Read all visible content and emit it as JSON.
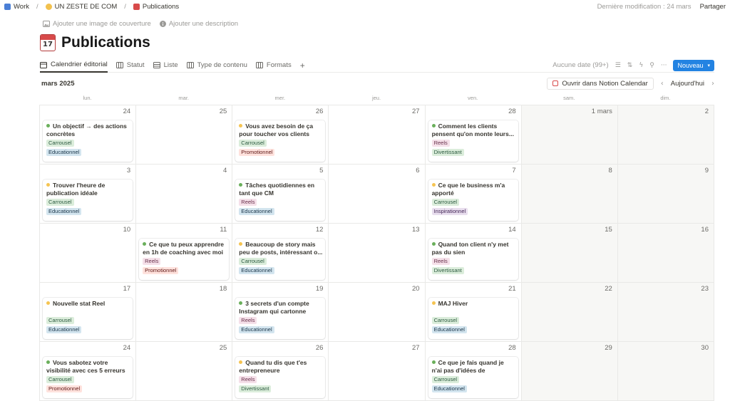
{
  "breadcrumb": {
    "items": [
      {
        "label": "Work",
        "color": "#4a7fd6"
      },
      {
        "label": "UN ZESTE DE COM",
        "color": "#f2c14e"
      },
      {
        "label": "Publications",
        "color": "#d84a4a"
      }
    ],
    "last_modified": "Dernière modification : 24 mars",
    "share": "Partager"
  },
  "page": {
    "add_cover": "Ajouter une image de couverture",
    "add_description": "Ajouter une description",
    "title": "Publications",
    "emoji_day": "17"
  },
  "views": {
    "tabs": [
      {
        "label": "Calendrier éditorial",
        "active": true
      },
      {
        "label": "Statut",
        "active": false
      },
      {
        "label": "Liste",
        "active": false
      },
      {
        "label": "Type de contenu",
        "active": false
      },
      {
        "label": "Formats",
        "active": false
      }
    ],
    "add": "+",
    "no_date": "Aucune date (99+)",
    "new_button": "Nouveau"
  },
  "calendar": {
    "month": "mars 2025",
    "open_button": "Ouvrir dans Notion Calendar",
    "today": "Aujourd'hui",
    "prev": "‹",
    "next": "›",
    "weekdays": [
      "lun.",
      "mar.",
      "mer.",
      "jeu.",
      "ven.",
      "sam.",
      "dim."
    ],
    "status_colors": {
      "green": "#6aaf5b",
      "yellow": "#f5c452"
    },
    "tag_colors": {
      "Carrousel": {
        "bg": "#dbeddb",
        "fg": "#2b593f"
      },
      "Reels": {
        "bg": "#f5e0e9",
        "fg": "#69314c"
      },
      "Educationnel": {
        "bg": "#d3e5ef",
        "fg": "#183347"
      },
      "Promotionnel": {
        "bg": "#ffe2dd",
        "fg": "#5d1715"
      },
      "Divertissant": {
        "bg": "#dbeddb",
        "fg": "#2b593f"
      },
      "Inspirationnel": {
        "bg": "#e8deee",
        "fg": "#412454"
      }
    },
    "weeks": [
      [
        {
          "day": "24",
          "post": {
            "status": "green",
            "title": "Un objectif → des actions concrètes",
            "format": "Carrousel",
            "type": "Educationnel"
          }
        },
        {
          "day": "25"
        },
        {
          "day": "26",
          "post": {
            "status": "yellow",
            "title": "Vous avez besoin de ça pour toucher vos clients",
            "format": "Carrousel",
            "type": "Promotionnel"
          }
        },
        {
          "day": "27"
        },
        {
          "day": "28",
          "post": {
            "status": "green",
            "title": "Comment les clients pensent qu'on monte leurs...",
            "format": "Reels",
            "type": "Divertissant"
          }
        },
        {
          "day": "1 mars"
        },
        {
          "day": "2"
        }
      ],
      [
        {
          "day": "3",
          "post": {
            "status": "yellow",
            "title": "Trouver l'heure de publication idéale",
            "format": "Carrousel",
            "type": "Educationnel"
          }
        },
        {
          "day": "4"
        },
        {
          "day": "5",
          "post": {
            "status": "green",
            "title": "Tâches quotidiennes en tant que CM",
            "format": "Reels",
            "type": "Educationnel"
          }
        },
        {
          "day": "6"
        },
        {
          "day": "7",
          "post": {
            "status": "yellow",
            "title": "Ce que le business m'a apporté",
            "format": "Carrousel",
            "type": "Inspirationnel"
          }
        },
        {
          "day": "8"
        },
        {
          "day": "9"
        }
      ],
      [
        {
          "day": "10"
        },
        {
          "day": "11",
          "post": {
            "status": "green",
            "title": "Ce que tu peux apprendre en 1h de coaching avec moi",
            "format": "Reels",
            "type": "Promotionnel"
          }
        },
        {
          "day": "12",
          "post": {
            "status": "yellow",
            "title": "Beaucoup de story mais peu de posts, intéressant o...",
            "format": "Carrousel",
            "type": "Educationnel"
          }
        },
        {
          "day": "13"
        },
        {
          "day": "14",
          "post": {
            "status": "green",
            "title": "Quand ton client n'y met pas du sien",
            "format": "Reels",
            "type": "Divertissant"
          }
        },
        {
          "day": "15"
        },
        {
          "day": "16"
        }
      ],
      [
        {
          "day": "17",
          "post": {
            "status": "yellow",
            "title": "Nouvelle stat Reel",
            "format": "Carrousel",
            "type": "Educationnel"
          }
        },
        {
          "day": "18"
        },
        {
          "day": "19",
          "post": {
            "status": "green",
            "title": "3 secrets d'un compte Instagram qui cartonne",
            "format": "Reels",
            "type": "Educationnel"
          }
        },
        {
          "day": "20"
        },
        {
          "day": "21",
          "post": {
            "status": "yellow",
            "title": "MAJ Hiver",
            "format": "Carrousel",
            "type": "Educationnel"
          }
        },
        {
          "day": "22"
        },
        {
          "day": "23"
        }
      ],
      [
        {
          "day": "24",
          "post": {
            "status": "green",
            "title": "Vous sabotez votre visibilité avec ces 5 erreurs",
            "format": "Carrousel",
            "type": "Promotionnel"
          }
        },
        {
          "day": "25"
        },
        {
          "day": "26",
          "post": {
            "status": "yellow",
            "title": "Quand tu dis que t'es entrepreneure",
            "format": "Reels",
            "type": "Divertissant"
          }
        },
        {
          "day": "27"
        },
        {
          "day": "28",
          "post": {
            "status": "green",
            "title": "Ce que je fais quand je n'ai pas d'idées de contenu...",
            "format": "Carrousel",
            "type": "Educationnel"
          }
        },
        {
          "day": "29"
        },
        {
          "day": "30"
        }
      ]
    ]
  }
}
